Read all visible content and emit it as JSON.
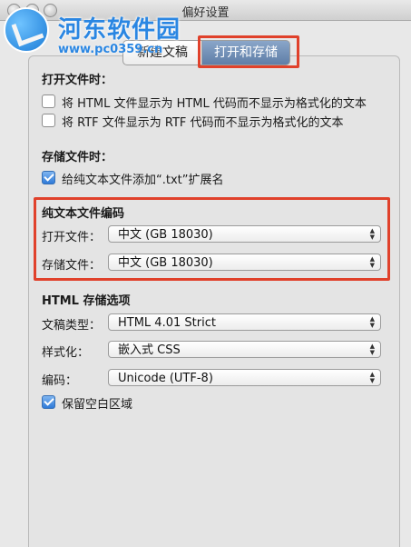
{
  "window": {
    "title": "偏好设置"
  },
  "watermark": {
    "name": "河东软件园",
    "url": "www.pc0359.cn"
  },
  "tabs": [
    {
      "label": "新建文稿"
    },
    {
      "label": "打开和存储"
    }
  ],
  "open_files": {
    "heading": "打开文件时：",
    "options": [
      {
        "label": "将 HTML 文件显示为 HTML 代码而不显示为格式化的文本",
        "checked": false
      },
      {
        "label": "将 RTF 文件显示为 RTF 代码而不显示为格式化的文本",
        "checked": false
      }
    ]
  },
  "save_files": {
    "heading": "存储文件时：",
    "options": [
      {
        "label": "给纯文本文件添加“.txt”扩展名",
        "checked": true
      }
    ]
  },
  "plain_text_encoding": {
    "heading": "纯文本文件编码",
    "open_label": "打开文件：",
    "open_value": "中文 (GB 18030)",
    "save_label": "存储文件：",
    "save_value": "中文 (GB 18030)"
  },
  "html_options": {
    "heading": "HTML 存储选项",
    "doc_type_label": "文稿类型：",
    "doc_type_value": "HTML 4.01 Strict",
    "style_label": "样式化：",
    "style_value": "嵌入式 CSS",
    "encoding_label": "编码：",
    "encoding_value": "Unicode (UTF-8)",
    "preserve_whitespace": {
      "label": "保留空白区域",
      "checked": true
    }
  },
  "colors": {
    "highlight": "#e0412b",
    "selected_tab": "#6f8db6",
    "checkbox_checked": "#2e7ad8"
  }
}
